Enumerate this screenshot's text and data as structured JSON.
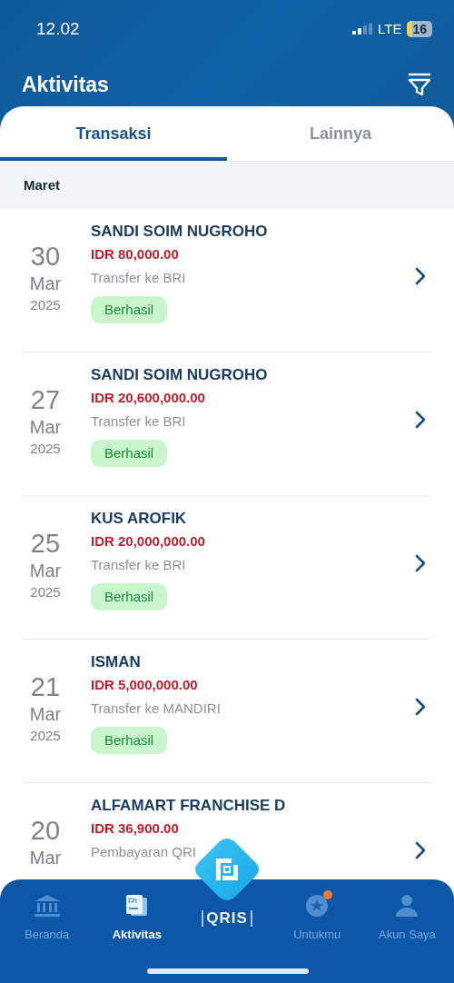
{
  "status_bar": {
    "time": "12.02",
    "network": "LTE",
    "battery": "16"
  },
  "header": {
    "title": "Aktivitas"
  },
  "tabs": [
    {
      "label": "Transaksi",
      "selected": true
    },
    {
      "label": "Lainnya",
      "selected": false
    }
  ],
  "section": "Maret",
  "transactions": [
    {
      "day": "30",
      "month": "Mar",
      "year": "2025",
      "name": "SANDI SOIM NUGROHO",
      "amount": "IDR 80,000.00",
      "description": "Transfer ke BRI",
      "status": "Berhasil"
    },
    {
      "day": "27",
      "month": "Mar",
      "year": "2025",
      "name": "SANDI SOIM NUGROHO",
      "amount": "IDR 20,600,000.00",
      "description": "Transfer ke BRI",
      "status": "Berhasil"
    },
    {
      "day": "25",
      "month": "Mar",
      "year": "2025",
      "name": "KUS AROFIK",
      "amount": "IDR 20,000,000.00",
      "description": "Transfer ke BRI",
      "status": "Berhasil"
    },
    {
      "day": "21",
      "month": "Mar",
      "year": "2025",
      "name": "ISMAN",
      "amount": "IDR 5,000,000.00",
      "description": "Transfer ke MANDIRI",
      "status": "Berhasil"
    },
    {
      "day": "20",
      "month": "Mar",
      "name": "ALFAMART FRANCHISE D",
      "amount": "IDR 36,900.00",
      "description": "Pembayaran QRI"
    }
  ],
  "bottom_nav": [
    {
      "kind": "home",
      "label": "Beranda",
      "selected": false
    },
    {
      "kind": "activity",
      "label": "Aktivitas",
      "selected": true
    },
    {
      "kind": "qris",
      "label": "QRIS",
      "selected": false
    },
    {
      "kind": "promo",
      "label": "Untukmu",
      "selected": false,
      "badge": true
    },
    {
      "kind": "account",
      "label": "Akun Saya",
      "selected": false
    }
  ]
}
